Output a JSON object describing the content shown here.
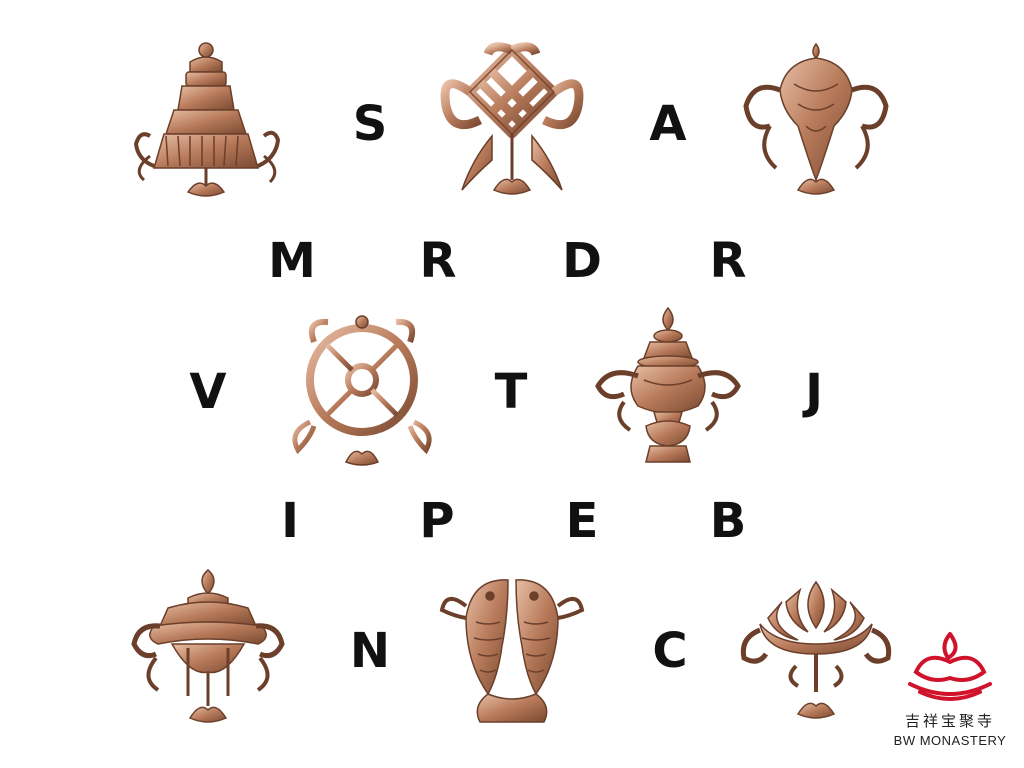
{
  "letters": {
    "row1": [
      "S",
      "A"
    ],
    "row2": [
      "M",
      "R",
      "D",
      "R"
    ],
    "row3": [
      "V",
      "T",
      "J"
    ],
    "row4": [
      "I",
      "P",
      "E",
      "B"
    ],
    "row5": [
      "N",
      "C"
    ]
  },
  "symbols": [
    "parasol",
    "endless-knot",
    "conch",
    "dharma-wheel",
    "treasure-vase",
    "victory-banner",
    "golden-fish",
    "lotus"
  ],
  "logo": {
    "chinese_text": "吉祥宝聚寺",
    "english_text": "BW MONASTERY",
    "color": "#d0122b"
  },
  "colors": {
    "bronze_dark": "#7a4a32",
    "bronze_mid": "#b77a5a",
    "bronze_light": "#e2b49a"
  }
}
